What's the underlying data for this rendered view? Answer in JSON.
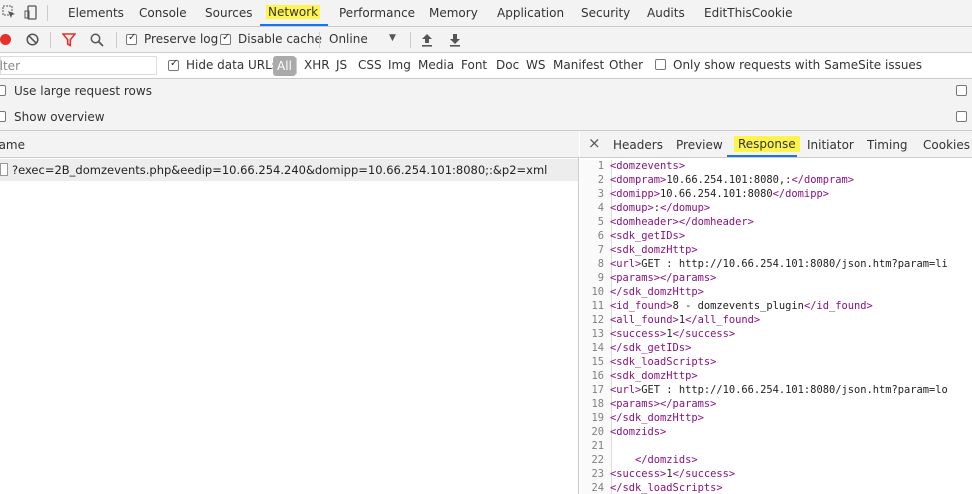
{
  "tabbar": {
    "tabs": [
      "Elements",
      "Console",
      "Sources",
      "Network",
      "Performance",
      "Memory",
      "Application",
      "Security",
      "Audits",
      "EditThisCookie"
    ],
    "active": "Network"
  },
  "toolbar": {
    "preserve_log": "Preserve log",
    "disable_cache": "Disable cache",
    "throttle": "Online",
    "throttle_arrow": "▼"
  },
  "filterbar": {
    "filter_placeholder": "Filter",
    "hide_data_urls": "Hide data URLs",
    "types": [
      "All",
      "XHR",
      "JS",
      "CSS",
      "Img",
      "Media",
      "Font",
      "Doc",
      "WS",
      "Manifest",
      "Other"
    ],
    "samesite": "Only show requests with SameSite issues"
  },
  "options": {
    "large_rows": "Use large request rows",
    "overview": "Show overview"
  },
  "requests": {
    "header": "Name",
    "rows": [
      "?exec=2B_domzevents.php&eedip=10.66.254.240&domipp=10.66.254.101:8080;:&p2=xml"
    ]
  },
  "details": {
    "close": "×",
    "tabs": [
      "Headers",
      "Preview",
      "Response",
      "Initiator",
      "Timing",
      "Cookies"
    ],
    "active": "Response"
  },
  "response_lines": [
    [
      "1",
      "<domzevents>",
      ""
    ],
    [
      "2",
      "<dompram>",
      "10.66.254.101:8080,:",
      "</dompram>"
    ],
    [
      "3",
      "<domipp>",
      "10.66.254.101:8080",
      "</domipp>"
    ],
    [
      "4",
      "<domup>",
      ":",
      "</domup>"
    ],
    [
      "5",
      "<domheader>",
      "",
      "</domheader>"
    ],
    [
      "6",
      "<sdk_getIDs>",
      ""
    ],
    [
      "7",
      "<sdk_domzHttp>",
      ""
    ],
    [
      "8",
      "<url>",
      "GET : http://10.66.254.101:8080/json.htm?param=li"
    ],
    [
      "9",
      "<params>",
      "",
      "</params>"
    ],
    [
      "10",
      "</sdk_domzHttp>",
      ""
    ],
    [
      "11",
      "<id_found>",
      "8 - domzevents_plugin",
      "</id_found>"
    ],
    [
      "12",
      "<all_found>",
      "1",
      "</all_found>"
    ],
    [
      "13",
      "<success>",
      "1",
      "</success>"
    ],
    [
      "14",
      "</sdk_getIDs>",
      ""
    ],
    [
      "15",
      "<sdk_loadScripts>",
      ""
    ],
    [
      "16",
      "<sdk_domzHttp>",
      ""
    ],
    [
      "17",
      "<url>",
      "GET : http://10.66.254.101:8080/json.htm?param=lo"
    ],
    [
      "18",
      "<params>",
      "",
      "</params>"
    ],
    [
      "19",
      "</sdk_domzHttp>",
      ""
    ],
    [
      "20",
      "<domzids>",
      ""
    ],
    [
      "21",
      "",
      ""
    ],
    [
      "22",
      "",
      "    ",
      "</domzids>"
    ],
    [
      "23",
      "<success>",
      "1",
      "</success>"
    ],
    [
      "24",
      "</sdk_loadScripts>",
      ""
    ]
  ],
  "colors": {
    "highlight": "#fff34d",
    "active_underline": "#1a73e8",
    "tag": "#881280",
    "record": "#e8302a",
    "filter": "#e8302a"
  }
}
